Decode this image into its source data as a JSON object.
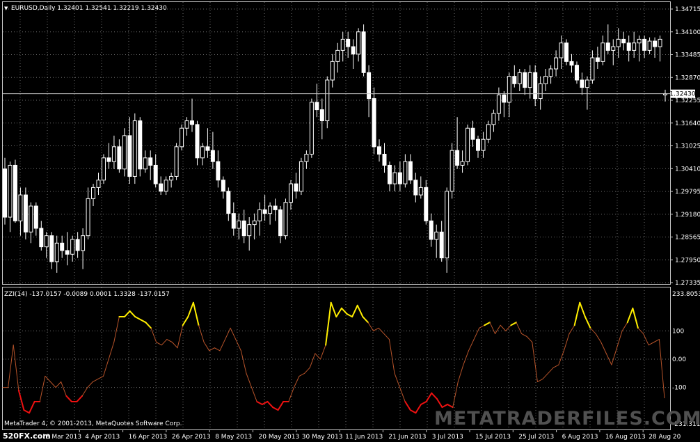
{
  "main_header": {
    "arrow": "▼",
    "text": "EURUSD,Daily  1.32401 1.32541 1.32219 1.32430"
  },
  "indicator_header": {
    "text": "ZZI(14) -137.0157 -0.0089 0.0001 1.3328 -137.0157"
  },
  "footer": {
    "copyright": "MetaTrader 4, © 2001-2013, MetaQuotes Software Corp.",
    "brand": "520FX.com",
    "watermark": "METATRADERFILES.COM"
  },
  "colors": {
    "background": "#000000",
    "grid": "#c8c8c8",
    "candle": "#ffffff",
    "osc_mid": "#b8542a",
    "osc_high": "#ffee00",
    "osc_low": "#ee1111"
  },
  "chart_data": [
    {
      "type": "candlestick",
      "price_axis": {
        "labels": [
          "1.34715",
          "1.34100",
          "1.33485",
          "1.32870",
          "1.32255",
          "1.31640",
          "1.31025",
          "1.30410",
          "1.29795",
          "1.29180",
          "1.28565",
          "1.27950",
          "1.27335"
        ],
        "range": [
          1.27335,
          1.34715
        ]
      },
      "current_price": {
        "label": "1.32430",
        "value": 1.3243
      },
      "date_axis": [
        "28 Mar 2013",
        "4 Apr 2013",
        "16 Apr 2013",
        "26 Apr 2013",
        "8 May 2013",
        "20 May 2013",
        "30 May 2013",
        "11 Jun 2013",
        "21 Jun 2013",
        "3 Jul 2013",
        "15 Jul 2013",
        "25 Jul 2013",
        "6 Aug 2013",
        "16 Aug 2013",
        "28 Aug 20"
      ],
      "grid": true,
      "ohlc": [
        [
          1.304,
          1.307,
          1.289,
          1.291
        ],
        [
          1.291,
          1.306,
          1.287,
          1.305
        ],
        [
          1.305,
          1.3065,
          1.2895,
          1.29
        ],
        [
          1.29,
          1.299,
          1.286,
          1.297
        ],
        [
          1.297,
          1.299,
          1.285,
          1.287
        ],
        [
          1.287,
          1.295,
          1.284,
          1.294
        ],
        [
          1.294,
          1.295,
          1.286,
          1.288
        ],
        [
          1.288,
          1.29,
          1.282,
          1.283
        ],
        [
          1.283,
          1.287,
          1.28,
          1.286
        ],
        [
          1.286,
          1.287,
          1.277,
          1.279
        ],
        [
          1.279,
          1.286,
          1.276,
          1.284
        ],
        [
          1.284,
          1.286,
          1.28,
          1.282
        ],
        [
          1.282,
          1.287,
          1.278,
          1.281
        ],
        [
          1.281,
          1.286,
          1.279,
          1.285
        ],
        [
          1.285,
          1.287,
          1.28,
          1.282
        ],
        [
          1.282,
          1.288,
          1.277,
          1.286
        ],
        [
          1.286,
          1.299,
          1.285,
          1.296
        ],
        [
          1.296,
          1.3,
          1.294,
          1.299
        ],
        [
          1.299,
          1.303,
          1.297,
          1.301
        ],
        [
          1.301,
          1.308,
          1.3,
          1.307
        ],
        [
          1.307,
          1.311,
          1.304,
          1.306
        ],
        [
          1.306,
          1.313,
          1.304,
          1.31
        ],
        [
          1.31,
          1.312,
          1.303,
          1.304
        ],
        [
          1.304,
          1.315,
          1.302,
          1.313
        ],
        [
          1.313,
          1.318,
          1.3,
          1.302
        ],
        [
          1.302,
          1.319,
          1.3,
          1.317
        ],
        [
          1.317,
          1.318,
          1.302,
          1.304
        ],
        [
          1.304,
          1.309,
          1.303,
          1.307
        ],
        [
          1.307,
          1.309,
          1.301,
          1.305
        ],
        [
          1.305,
          1.308,
          1.299,
          1.3
        ],
        [
          1.3,
          1.302,
          1.297,
          1.298
        ],
        [
          1.298,
          1.302,
          1.297,
          1.301
        ],
        [
          1.301,
          1.303,
          1.299,
          1.302
        ],
        [
          1.302,
          1.311,
          1.301,
          1.31
        ],
        [
          1.31,
          1.316,
          1.309,
          1.315
        ],
        [
          1.315,
          1.318,
          1.313,
          1.317
        ],
        [
          1.317,
          1.323,
          1.314,
          1.316
        ],
        [
          1.316,
          1.317,
          1.305,
          1.307
        ],
        [
          1.307,
          1.311,
          1.305,
          1.31
        ],
        [
          1.31,
          1.315,
          1.307,
          1.309
        ],
        [
          1.309,
          1.314,
          1.304,
          1.306
        ],
        [
          1.306,
          1.309,
          1.299,
          1.301
        ],
        [
          1.301,
          1.302,
          1.296,
          1.298
        ],
        [
          1.298,
          1.299,
          1.29,
          1.292
        ],
        [
          1.292,
          1.295,
          1.286,
          1.288
        ],
        [
          1.288,
          1.292,
          1.285,
          1.29
        ],
        [
          1.29,
          1.293,
          1.284,
          1.286
        ],
        [
          1.286,
          1.291,
          1.282,
          1.289
        ],
        [
          1.289,
          1.292,
          1.285,
          1.29
        ],
        [
          1.29,
          1.295,
          1.286,
          1.293
        ],
        [
          1.293,
          1.297,
          1.29,
          1.292
        ],
        [
          1.292,
          1.295,
          1.289,
          1.294
        ],
        [
          1.294,
          1.296,
          1.29,
          1.293
        ],
        [
          1.293,
          1.294,
          1.284,
          1.286
        ],
        [
          1.286,
          1.296,
          1.285,
          1.295
        ],
        [
          1.295,
          1.301,
          1.293,
          1.3
        ],
        [
          1.3,
          1.303,
          1.296,
          1.298
        ],
        [
          1.298,
          1.307,
          1.297,
          1.306
        ],
        [
          1.306,
          1.309,
          1.304,
          1.308
        ],
        [
          1.308,
          1.323,
          1.307,
          1.322
        ],
        [
          1.322,
          1.327,
          1.318,
          1.32
        ],
        [
          1.32,
          1.323,
          1.312,
          1.317
        ],
        [
          1.317,
          1.329,
          1.315,
          1.328
        ],
        [
          1.328,
          1.335,
          1.326,
          1.333
        ],
        [
          1.333,
          1.338,
          1.33,
          1.336
        ],
        [
          1.336,
          1.341,
          1.333,
          1.339
        ],
        [
          1.339,
          1.341,
          1.334,
          1.337
        ],
        [
          1.337,
          1.339,
          1.331,
          1.335
        ],
        [
          1.335,
          1.342,
          1.333,
          1.341
        ],
        [
          1.341,
          1.343,
          1.329,
          1.33
        ],
        [
          1.33,
          1.332,
          1.318,
          1.323
        ],
        [
          1.323,
          1.326,
          1.308,
          1.31
        ],
        [
          1.31,
          1.312,
          1.306,
          1.308
        ],
        [
          1.308,
          1.311,
          1.303,
          1.305
        ],
        [
          1.305,
          1.306,
          1.298,
          1.3
        ],
        [
          1.3,
          1.305,
          1.298,
          1.303
        ],
        [
          1.303,
          1.306,
          1.298,
          1.3
        ],
        [
          1.3,
          1.308,
          1.299,
          1.306
        ],
        [
          1.306,
          1.308,
          1.3,
          1.301
        ],
        [
          1.301,
          1.303,
          1.295,
          1.297
        ],
        [
          1.297,
          1.302,
          1.296,
          1.299
        ],
        [
          1.299,
          1.301,
          1.289,
          1.29
        ],
        [
          1.29,
          1.292,
          1.283,
          1.285
        ],
        [
          1.285,
          1.289,
          1.28,
          1.287
        ],
        [
          1.287,
          1.29,
          1.279,
          1.28
        ],
        [
          1.28,
          1.299,
          1.276,
          1.298
        ],
        [
          1.298,
          1.311,
          1.296,
          1.309
        ],
        [
          1.309,
          1.318,
          1.304,
          1.305
        ],
        [
          1.305,
          1.309,
          1.303,
          1.306
        ],
        [
          1.306,
          1.316,
          1.305,
          1.315
        ],
        [
          1.315,
          1.317,
          1.31,
          1.312
        ],
        [
          1.312,
          1.313,
          1.307,
          1.309
        ],
        [
          1.309,
          1.314,
          1.307,
          1.312
        ],
        [
          1.312,
          1.317,
          1.311,
          1.316
        ],
        [
          1.316,
          1.32,
          1.314,
          1.319
        ],
        [
          1.319,
          1.326,
          1.317,
          1.324
        ],
        [
          1.324,
          1.325,
          1.318,
          1.322
        ],
        [
          1.322,
          1.33,
          1.318,
          1.329
        ],
        [
          1.329,
          1.332,
          1.326,
          1.327
        ],
        [
          1.327,
          1.331,
          1.325,
          1.33
        ],
        [
          1.33,
          1.331,
          1.324,
          1.326
        ],
        [
          1.326,
          1.332,
          1.323,
          1.33
        ],
        [
          1.33,
          1.332,
          1.321,
          1.323
        ],
        [
          1.323,
          1.329,
          1.32,
          1.327
        ],
        [
          1.327,
          1.331,
          1.325,
          1.329
        ],
        [
          1.329,
          1.332,
          1.327,
          1.331
        ],
        [
          1.331,
          1.336,
          1.329,
          1.334
        ],
        [
          1.334,
          1.34,
          1.331,
          1.338
        ],
        [
          1.338,
          1.339,
          1.332,
          1.333
        ],
        [
          1.333,
          1.335,
          1.33,
          1.332
        ],
        [
          1.332,
          1.333,
          1.327,
          1.328
        ],
        [
          1.328,
          1.33,
          1.324,
          1.326
        ],
        [
          1.326,
          1.329,
          1.32,
          1.328
        ],
        [
          1.328,
          1.336,
          1.327,
          1.334
        ],
        [
          1.334,
          1.337,
          1.331,
          1.333
        ],
        [
          1.333,
          1.34,
          1.332,
          1.338
        ],
        [
          1.338,
          1.343,
          1.335,
          1.336
        ],
        [
          1.336,
          1.339,
          1.332,
          1.337
        ],
        [
          1.337,
          1.342,
          1.334,
          1.339
        ],
        [
          1.339,
          1.341,
          1.336,
          1.338
        ],
        [
          1.338,
          1.34,
          1.333,
          1.336
        ],
        [
          1.336,
          1.341,
          1.334,
          1.338
        ],
        [
          1.338,
          1.34,
          1.333,
          1.339
        ],
        [
          1.339,
          1.34,
          1.334,
          1.336
        ],
        [
          1.336,
          1.3395,
          1.335,
          1.3385
        ],
        [
          1.3385,
          1.3395,
          1.334,
          1.337
        ],
        [
          1.337,
          1.34,
          1.333,
          1.339
        ],
        [
          1.324,
          1.3254,
          1.3222,
          1.3243
        ]
      ]
    },
    {
      "type": "line",
      "title": "ZZI(14)",
      "value_axis": {
        "labels": [
          "233.8053",
          "100",
          "0.00",
          "-100",
          "-231.3115"
        ],
        "range": [
          -231.3115,
          233.8053
        ]
      },
      "grid": true,
      "series": [
        {
          "values": [
            -100,
            -100,
            50,
            -110,
            -180,
            -190,
            -150,
            -150,
            -60,
            -80,
            -100,
            -80,
            -130,
            -150,
            -150,
            -130,
            -100,
            -80,
            -70,
            -60,
            0,
            60,
            150,
            150,
            170,
            150,
            140,
            130,
            110,
            60,
            50,
            70,
            60,
            40,
            120,
            150,
            200,
            120,
            60,
            30,
            40,
            30,
            70,
            110,
            70,
            30,
            -50,
            -100,
            -150,
            -160,
            -150,
            -170,
            -180,
            -150,
            -150,
            -100,
            -60,
            -50,
            -30,
            20,
            0,
            50,
            200,
            150,
            180,
            160,
            150,
            190,
            150,
            130,
            100,
            110,
            90,
            70,
            -50,
            -100,
            -150,
            -180,
            -190,
            -160,
            -150,
            -120,
            -140,
            -170,
            -160,
            -170,
            -80,
            -20,
            30,
            70,
            110,
            120,
            130,
            90,
            120,
            100,
            120,
            130,
            90,
            80,
            60,
            -80,
            -70,
            -50,
            -30,
            -20,
            30,
            90,
            120,
            200,
            150,
            110,
            90,
            60,
            20,
            -20,
            40,
            100,
            130,
            180,
            110,
            90,
            50,
            60,
            70,
            -137.0157
          ]
        }
      ]
    }
  ]
}
